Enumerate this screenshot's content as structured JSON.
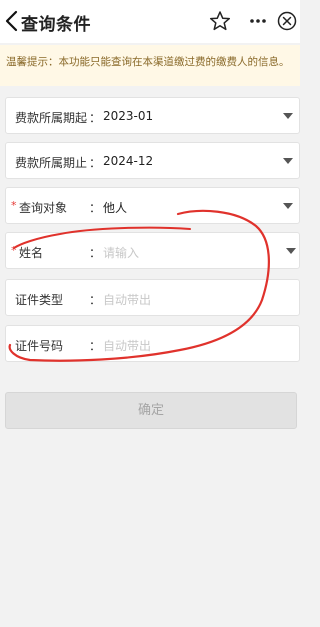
{
  "header": {
    "title": "查询条件",
    "back_icon": "chevron-left-icon",
    "star_icon": "star-icon",
    "more_icon": "more-icon",
    "close_icon": "close-circle-icon"
  },
  "notice": {
    "text": "温馨提示：本功能只能查询在本渠道缴过费的缴费人的信息。"
  },
  "form": {
    "period_start": {
      "label": "费款所属期起",
      "colon": "：",
      "value": "2023-01"
    },
    "period_end": {
      "label": "费款所属期止",
      "colon": "：",
      "value": "2024-12"
    },
    "query_target": {
      "required": "*",
      "label": "查询对象",
      "colon": "：",
      "value": "他人"
    },
    "name": {
      "required": "*",
      "label": "姓名",
      "colon": "：",
      "placeholder": "请输入"
    },
    "id_type": {
      "label": "证件类型",
      "colon": "：",
      "placeholder": "自动带出"
    },
    "id_number": {
      "label": "证件号码",
      "colon": "：",
      "placeholder": "自动带出"
    }
  },
  "confirm_button": {
    "label": "确定"
  },
  "colors": {
    "required": "#e53935",
    "notice_bg": "#fff8e6",
    "annotation": "#e0322c"
  }
}
